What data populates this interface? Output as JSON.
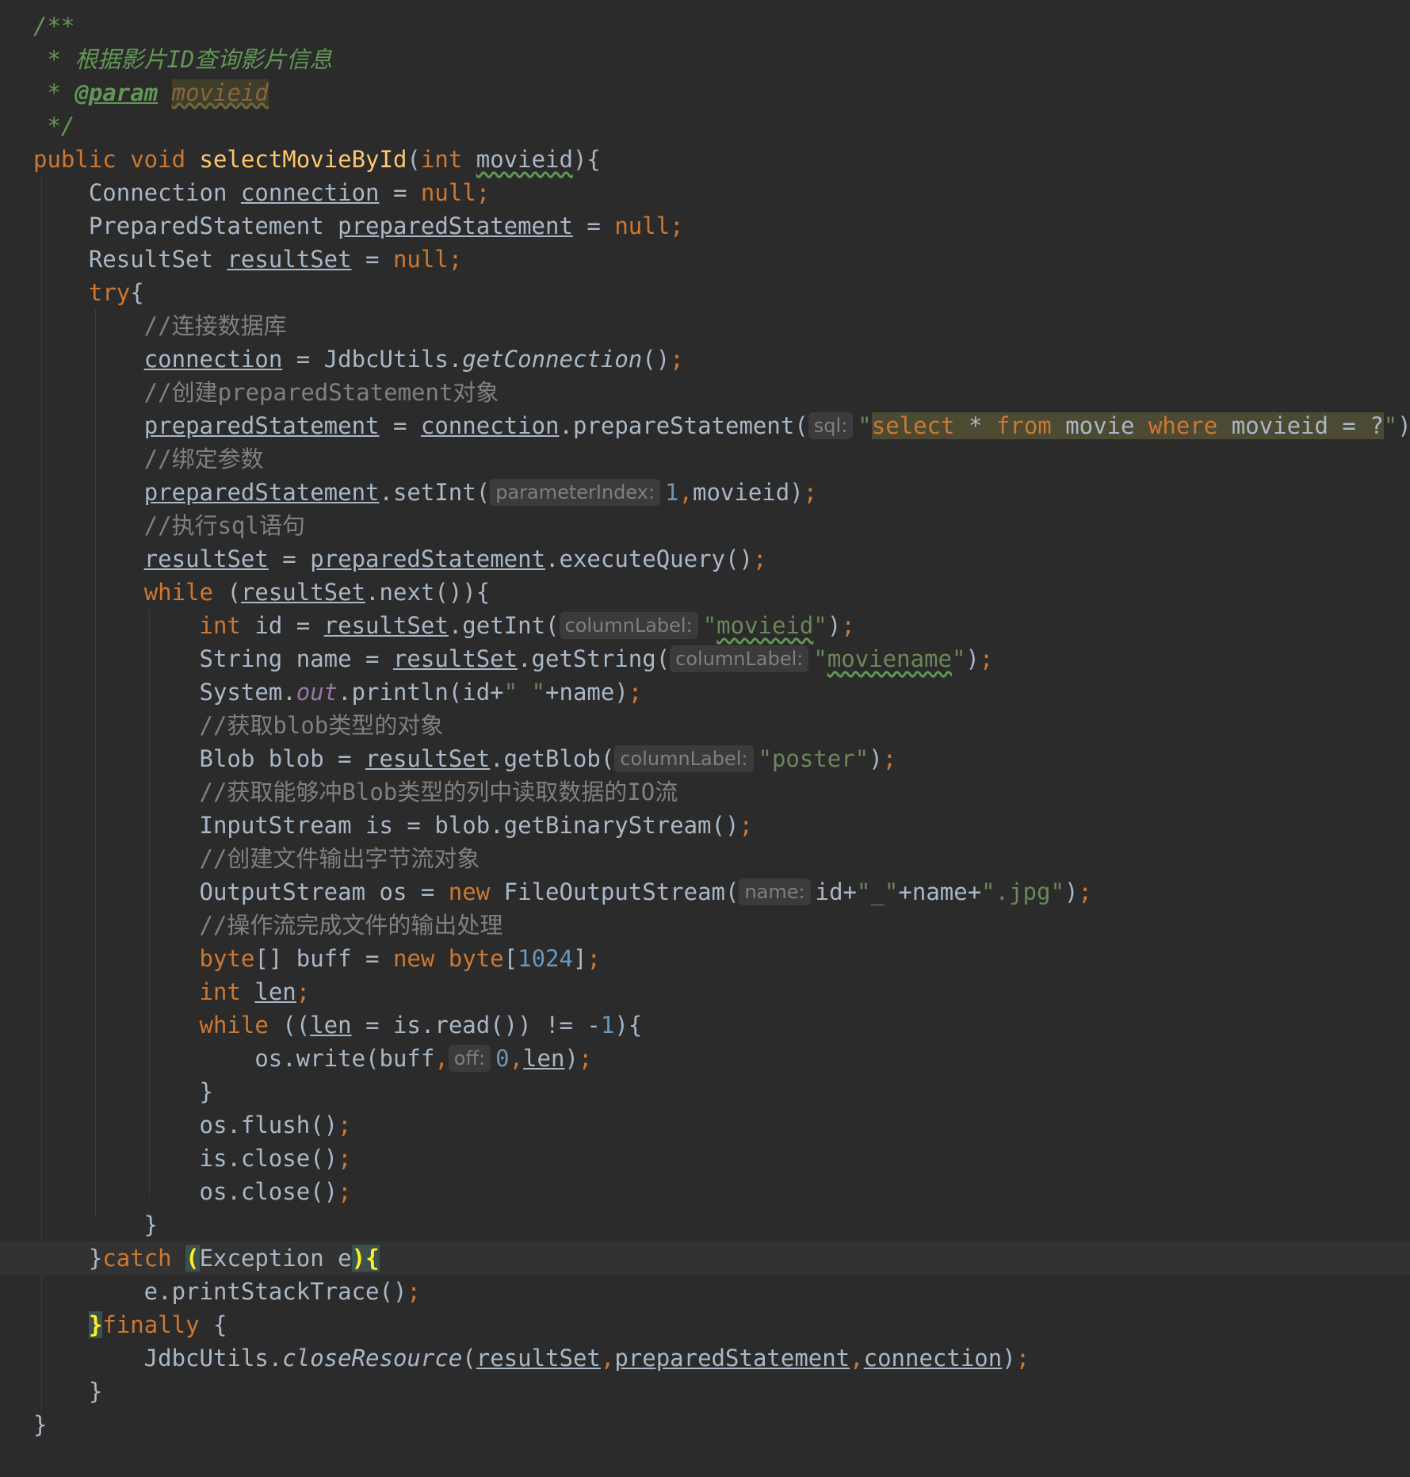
{
  "editor": {
    "theme": "darcula",
    "colors": {
      "background": "#2b2b2b",
      "current_line": "#323232",
      "keyword": "#cc7832",
      "method_decl": "#ffc66d",
      "string": "#6a8759",
      "number": "#6897bb",
      "comment": "#808080",
      "javadoc": "#629755",
      "static_field": "#9876aa",
      "brace_match": "#ffef28"
    },
    "lines": [
      {
        "tokens": [
          {
            "t": "/**",
            "c": "doc"
          }
        ]
      },
      {
        "tokens": [
          {
            "t": " * 根据影片ID查询影片信息",
            "c": "doc"
          }
        ]
      },
      {
        "tokens": [
          {
            "t": " * ",
            "c": "doc"
          },
          {
            "t": "@param",
            "c": "doctag"
          },
          {
            "t": " ",
            "c": "doc"
          },
          {
            "t": "movieid",
            "c": "docparam"
          }
        ]
      },
      {
        "tokens": [
          {
            "t": " */",
            "c": "doc"
          }
        ]
      },
      {
        "tokens": [
          {
            "t": "public void ",
            "c": "kw"
          },
          {
            "t": "selectMovieById",
            "c": "fn"
          },
          {
            "t": "(",
            "c": "plain"
          },
          {
            "t": "int ",
            "c": "kw"
          },
          {
            "t": "movieid",
            "c": "plain wavy"
          },
          {
            "t": "){",
            "c": "plain"
          }
        ]
      },
      {
        "tokens": [
          {
            "t": "    Connection ",
            "c": "plain"
          },
          {
            "t": "connection",
            "c": "plain under"
          },
          {
            "t": " = ",
            "c": "plain"
          },
          {
            "t": "null;",
            "c": "kw"
          }
        ]
      },
      {
        "tokens": [
          {
            "t": "    PreparedStatement ",
            "c": "plain"
          },
          {
            "t": "preparedStatement",
            "c": "plain under"
          },
          {
            "t": " = ",
            "c": "plain"
          },
          {
            "t": "null;",
            "c": "kw"
          }
        ]
      },
      {
        "tokens": [
          {
            "t": "    ResultSet ",
            "c": "plain"
          },
          {
            "t": "resultSet",
            "c": "plain under"
          },
          {
            "t": " = ",
            "c": "plain"
          },
          {
            "t": "null;",
            "c": "kw"
          }
        ]
      },
      {
        "tokens": [
          {
            "t": "    ",
            "c": "plain"
          },
          {
            "t": "try",
            "c": "kw"
          },
          {
            "t": "{",
            "c": "plain"
          }
        ]
      },
      {
        "tokens": [
          {
            "t": "        //连接数据库",
            "c": "cmt"
          }
        ]
      },
      {
        "tokens": [
          {
            "t": "        ",
            "c": "plain"
          },
          {
            "t": "connection",
            "c": "plain under"
          },
          {
            "t": " = JdbcUtils.",
            "c": "plain"
          },
          {
            "t": "getConnection",
            "c": "plain ital"
          },
          {
            "t": "()",
            "c": "plain"
          },
          {
            "t": ";",
            "c": "kw"
          }
        ]
      },
      {
        "tokens": [
          {
            "t": "        //创建preparedStatement对象",
            "c": "cmt"
          }
        ]
      },
      {
        "tokens": [
          {
            "t": "        ",
            "c": "plain"
          },
          {
            "t": "preparedStatement",
            "c": "plain under"
          },
          {
            "t": " = ",
            "c": "plain"
          },
          {
            "t": "connection",
            "c": "plain under"
          },
          {
            "t": ".prepareStatement(",
            "c": "plain"
          },
          {
            "t": "sql:",
            "c": "hint"
          },
          {
            "t": "\"",
            "c": "str"
          },
          {
            "t": "select",
            "c": "sqlkw sql-bg"
          },
          {
            "t": " * ",
            "c": "sqlplain sql-bg"
          },
          {
            "t": "from",
            "c": "sqlkw sql-bg"
          },
          {
            "t": " movie ",
            "c": "sqlplain sql-bg"
          },
          {
            "t": "where",
            "c": "sqlkw sql-bg"
          },
          {
            "t": " movieid = ?",
            "c": "sqlplain sql-bg"
          },
          {
            "t": "\"",
            "c": "str"
          },
          {
            "t": ")",
            "c": "plain"
          },
          {
            "t": ";",
            "c": "kw"
          }
        ]
      },
      {
        "tokens": [
          {
            "t": "        //绑定参数",
            "c": "cmt"
          }
        ]
      },
      {
        "tokens": [
          {
            "t": "        ",
            "c": "plain"
          },
          {
            "t": "preparedStatement",
            "c": "plain under"
          },
          {
            "t": ".setInt(",
            "c": "plain"
          },
          {
            "t": "parameterIndex:",
            "c": "hint"
          },
          {
            "t": "1",
            "c": "num"
          },
          {
            "t": ",",
            "c": "kw"
          },
          {
            "t": "movieid)",
            "c": "plain"
          },
          {
            "t": ";",
            "c": "kw"
          }
        ]
      },
      {
        "tokens": [
          {
            "t": "        //执行sql语句",
            "c": "cmt"
          }
        ]
      },
      {
        "tokens": [
          {
            "t": "        ",
            "c": "plain"
          },
          {
            "t": "resultSet",
            "c": "plain under"
          },
          {
            "t": " = ",
            "c": "plain"
          },
          {
            "t": "preparedStatement",
            "c": "plain under"
          },
          {
            "t": ".executeQuery()",
            "c": "plain"
          },
          {
            "t": ";",
            "c": "kw"
          }
        ]
      },
      {
        "tokens": [
          {
            "t": "        ",
            "c": "plain"
          },
          {
            "t": "while",
            "c": "kw"
          },
          {
            "t": " (",
            "c": "plain"
          },
          {
            "t": "resultSet",
            "c": "plain under"
          },
          {
            "t": ".next()){",
            "c": "plain"
          }
        ]
      },
      {
        "tokens": [
          {
            "t": "            ",
            "c": "plain"
          },
          {
            "t": "int",
            "c": "kw"
          },
          {
            "t": " id = ",
            "c": "plain"
          },
          {
            "t": "resultSet",
            "c": "plain under"
          },
          {
            "t": ".getInt(",
            "c": "plain"
          },
          {
            "t": "columnLabel:",
            "c": "hint"
          },
          {
            "t": "\"",
            "c": "str"
          },
          {
            "t": "movieid",
            "c": "str wavy"
          },
          {
            "t": "\"",
            "c": "str"
          },
          {
            "t": ")",
            "c": "plain"
          },
          {
            "t": ";",
            "c": "kw"
          }
        ]
      },
      {
        "tokens": [
          {
            "t": "            String name = ",
            "c": "plain"
          },
          {
            "t": "resultSet",
            "c": "plain under"
          },
          {
            "t": ".getString(",
            "c": "plain"
          },
          {
            "t": "columnLabel:",
            "c": "hint"
          },
          {
            "t": "\"",
            "c": "str"
          },
          {
            "t": "moviename",
            "c": "str wavy"
          },
          {
            "t": "\"",
            "c": "str"
          },
          {
            "t": ")",
            "c": "plain"
          },
          {
            "t": ";",
            "c": "kw"
          }
        ]
      },
      {
        "tokens": [
          {
            "t": "            System.",
            "c": "plain"
          },
          {
            "t": "out",
            "c": "static"
          },
          {
            "t": ".println(id+",
            "c": "plain"
          },
          {
            "t": "\" \"",
            "c": "str"
          },
          {
            "t": "+name)",
            "c": "plain"
          },
          {
            "t": ";",
            "c": "kw"
          }
        ]
      },
      {
        "tokens": [
          {
            "t": "            //获取blob类型的对象",
            "c": "cmt"
          }
        ]
      },
      {
        "tokens": [
          {
            "t": "            Blob blob = ",
            "c": "plain"
          },
          {
            "t": "resultSet",
            "c": "plain under"
          },
          {
            "t": ".getBlob(",
            "c": "plain"
          },
          {
            "t": "columnLabel:",
            "c": "hint"
          },
          {
            "t": "\"poster\"",
            "c": "str"
          },
          {
            "t": ")",
            "c": "plain"
          },
          {
            "t": ";",
            "c": "kw"
          }
        ]
      },
      {
        "tokens": [
          {
            "t": "            //获取能够冲Blob类型的列中读取数据的IO流",
            "c": "cmt"
          }
        ]
      },
      {
        "tokens": [
          {
            "t": "            InputStream is = blob.getBinaryStream()",
            "c": "plain"
          },
          {
            "t": ";",
            "c": "kw"
          }
        ]
      },
      {
        "tokens": [
          {
            "t": "            //创建文件输出字节流对象",
            "c": "cmt"
          }
        ]
      },
      {
        "tokens": [
          {
            "t": "            OutputStream os = ",
            "c": "plain"
          },
          {
            "t": "new",
            "c": "kw"
          },
          {
            "t": " FileOutputStream(",
            "c": "plain"
          },
          {
            "t": "name:",
            "c": "hint"
          },
          {
            "t": "id+",
            "c": "plain"
          },
          {
            "t": "\"_\"",
            "c": "str"
          },
          {
            "t": "+name+",
            "c": "plain"
          },
          {
            "t": "\".jpg\"",
            "c": "str"
          },
          {
            "t": ")",
            "c": "plain"
          },
          {
            "t": ";",
            "c": "kw"
          }
        ]
      },
      {
        "tokens": [
          {
            "t": "            //操作流完成文件的输出处理",
            "c": "cmt"
          }
        ]
      },
      {
        "tokens": [
          {
            "t": "            ",
            "c": "plain"
          },
          {
            "t": "byte",
            "c": "kw"
          },
          {
            "t": "[] buff = ",
            "c": "plain"
          },
          {
            "t": "new byte",
            "c": "kw"
          },
          {
            "t": "[",
            "c": "plain"
          },
          {
            "t": "1024",
            "c": "num"
          },
          {
            "t": "]",
            "c": "plain"
          },
          {
            "t": ";",
            "c": "kw"
          }
        ]
      },
      {
        "tokens": [
          {
            "t": "            ",
            "c": "plain"
          },
          {
            "t": "int",
            "c": "kw"
          },
          {
            "t": " ",
            "c": "plain"
          },
          {
            "t": "len",
            "c": "plain under"
          },
          {
            "t": ";",
            "c": "kw"
          }
        ]
      },
      {
        "tokens": [
          {
            "t": "            ",
            "c": "plain"
          },
          {
            "t": "while",
            "c": "kw"
          },
          {
            "t": " ((",
            "c": "plain"
          },
          {
            "t": "len",
            "c": "plain under"
          },
          {
            "t": " = is.read()) != -",
            "c": "plain"
          },
          {
            "t": "1",
            "c": "num"
          },
          {
            "t": "){",
            "c": "plain"
          }
        ]
      },
      {
        "tokens": [
          {
            "t": "                os.write(buff",
            "c": "plain"
          },
          {
            "t": ",",
            "c": "kw"
          },
          {
            "t": "off:",
            "c": "hint"
          },
          {
            "t": "0",
            "c": "num"
          },
          {
            "t": ",",
            "c": "kw"
          },
          {
            "t": "len",
            "c": "plain under"
          },
          {
            "t": ")",
            "c": "plain"
          },
          {
            "t": ";",
            "c": "kw"
          }
        ]
      },
      {
        "tokens": [
          {
            "t": "            }",
            "c": "plain"
          }
        ]
      },
      {
        "tokens": [
          {
            "t": "            os.flush()",
            "c": "plain"
          },
          {
            "t": ";",
            "c": "kw"
          }
        ]
      },
      {
        "tokens": [
          {
            "t": "            is.close()",
            "c": "plain"
          },
          {
            "t": ";",
            "c": "kw"
          }
        ]
      },
      {
        "tokens": [
          {
            "t": "            os.close()",
            "c": "plain"
          },
          {
            "t": ";",
            "c": "kw"
          }
        ]
      },
      {
        "tokens": [
          {
            "t": "        }",
            "c": "plain"
          }
        ]
      },
      {
        "current": true,
        "tokens": [
          {
            "t": "    }",
            "c": "plain"
          },
          {
            "t": "catch",
            "c": "kw"
          },
          {
            "t": " ",
            "c": "plain"
          },
          {
            "t": "(",
            "c": "brace-hl"
          },
          {
            "t": "Exception e",
            "c": "plain"
          },
          {
            "t": "){",
            "c": "brace-hl"
          }
        ]
      },
      {
        "tokens": [
          {
            "t": "        e.printStackTrace()",
            "c": "plain"
          },
          {
            "t": ";",
            "c": "kw"
          }
        ]
      },
      {
        "tokens": [
          {
            "t": "    ",
            "c": "plain"
          },
          {
            "t": "}",
            "c": "brace-hl"
          },
          {
            "t": "finally",
            "c": "kw"
          },
          {
            "t": " {",
            "c": "plain"
          }
        ]
      },
      {
        "tokens": [
          {
            "t": "        JdbcUtils.",
            "c": "plain"
          },
          {
            "t": "closeResource",
            "c": "plain ital"
          },
          {
            "t": "(",
            "c": "plain"
          },
          {
            "t": "resultSet",
            "c": "plain under"
          },
          {
            "t": ",",
            "c": "kw"
          },
          {
            "t": "preparedStatement",
            "c": "plain under"
          },
          {
            "t": ",",
            "c": "kw"
          },
          {
            "t": "connection",
            "c": "plain under"
          },
          {
            "t": ")",
            "c": "plain"
          },
          {
            "t": ";",
            "c": "kw"
          }
        ]
      },
      {
        "tokens": [
          {
            "t": "    }",
            "c": "plain"
          }
        ]
      },
      {
        "tokens": [
          {
            "t": "}",
            "c": "plain"
          }
        ]
      }
    ]
  }
}
